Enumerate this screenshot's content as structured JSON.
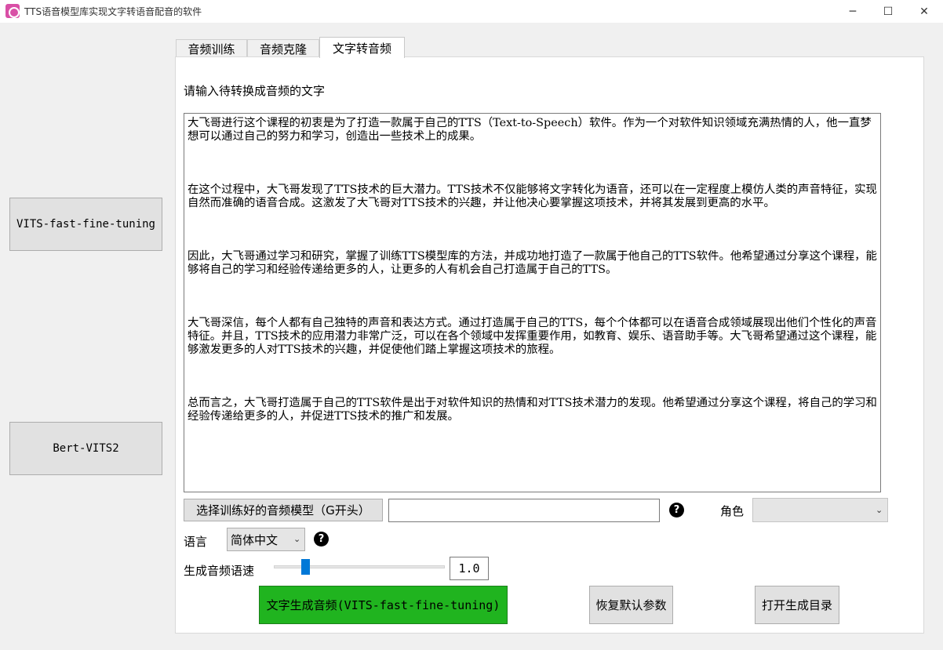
{
  "window": {
    "title": "TTS语音模型库实现文字转语音配音的软件",
    "minimize_glyph": "─",
    "maximize_glyph": "☐",
    "close_glyph": "✕"
  },
  "sidebar": {
    "buttons": [
      {
        "label": "VITS-fast-fine-tuning"
      },
      {
        "label": "Bert-VITS2"
      }
    ]
  },
  "tabs": [
    {
      "label": "音频训练",
      "active": false
    },
    {
      "label": "音频克隆",
      "active": false
    },
    {
      "label": "文字转音频",
      "active": true
    }
  ],
  "main": {
    "prompt_label": "请输入待转换成音频的文字",
    "text_paragraphs": [
      "大飞哥进行这个课程的初衷是为了打造一款属于自己的TTS（Text-to-Speech）软件。作为一个对软件知识领域充满热情的人，他一直梦想可以通过自己的努力和学习，创造出一些技术上的成果。",
      "在这个过程中，大飞哥发现了TTS技术的巨大潜力。TTS技术不仅能够将文字转化为语音，还可以在一定程度上模仿人类的声音特征，实现自然而准确的语音合成。这激发了大飞哥对TTS技术的兴趣，并让他决心要掌握这项技术，并将其发展到更高的水平。",
      "因此，大飞哥通过学习和研究，掌握了训练TTS模型库的方法，并成功地打造了一款属于他自己的TTS软件。他希望通过分享这个课程，能够将自己的学习和经验传递给更多的人，让更多的人有机会自己打造属于自己的TTS。",
      "大飞哥深信，每个人都有自己独特的声音和表达方式。通过打造属于自己的TTS，每个个体都可以在语音合成领域展现出他们个性化的声音特征。并且，TTS技术的应用潜力非常广泛，可以在各个领域中发挥重要作用，如教育、娱乐、语音助手等。大飞哥希望通过这个课程，能够激发更多的人对TTS技术的兴趣，并促使他们踏上掌握这项技术的旅程。",
      "总而言之，大飞哥打造属于自己的TTS软件是出于对软件知识的热情和对TTS技术潜力的发现。他希望通过分享这个课程，将自己的学习和经验传递给更多的人，并促进TTS技术的推广和发展。"
    ],
    "model_button_label": "选择训练好的音频模型（G开头）",
    "model_path_value": "",
    "help_glyph": "?",
    "role_label": "角色",
    "role_value": "",
    "language_label": "语言",
    "language_value": "简体中文",
    "speed_label": "生成音频语速",
    "speed_slider_fraction": 0.17,
    "speed_value": "1.0",
    "generate_button_label": "文字生成音频(VITS-fast-fine-tuning)",
    "reset_button_label": "恢复默认参数",
    "open_dir_button_label": "打开生成目录"
  },
  "colors": {
    "generate_button": "#20b41f",
    "slider_thumb": "#0078d7"
  }
}
